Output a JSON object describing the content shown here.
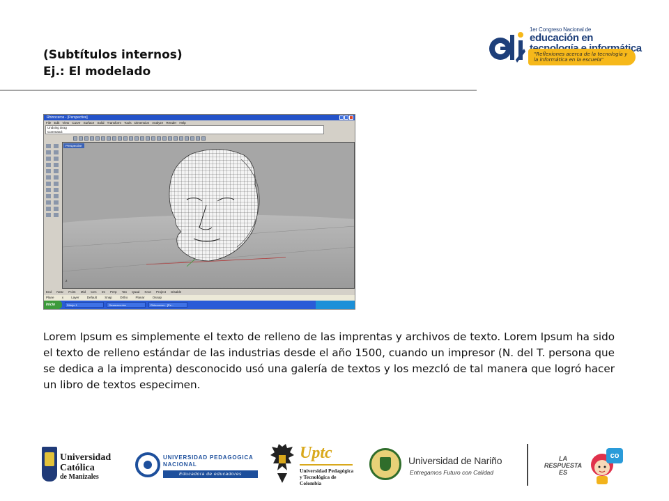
{
  "header": {
    "subtitle_line1": "(Subtítulos internos)",
    "subtitle_line2": "Ej.: El modelado"
  },
  "event_logo": {
    "mark": "eti",
    "line1": "1er Congreso Nacional de",
    "line2": "educación en",
    "line3": "tecnología e informática",
    "tagline": "\"Reflexiones acerca de la tecnología y la informática en la escuela\"",
    "accent_color": "#f6b81a",
    "brand_color": "#1e3f7a"
  },
  "screenshot": {
    "window_title": "Rhinoceros - [Perspective]",
    "menu": "File  Edit  View  Curve  Surface  Solid  Transform  Tools  Dimension  Analyze  Render  Help",
    "command_history": "Undoing Drag",
    "command_prompt": "Command:",
    "viewport_label": "Perspective",
    "osnap_row": "End  Near  Point  Mid  Cen  Int  Perp  Tan  Quad  Knot  Project  Disable",
    "status_row": "Plane  x  Layer  Default  Snap  Ortho  Planar  Osnap",
    "start_label": "Inicio",
    "tasks": [
      "Dibujo 1",
      "Gesaurus.doc",
      "Rhinoceros - [Pe..."
    ]
  },
  "body": {
    "paragraph": "Lorem Ipsum es simplemente el texto de relleno de las imprentas y archivos de texto. Lorem Ipsum ha sido el texto de relleno estándar de las industrias desde el año 1500, cuando un impresor (N. del T. persona que se dedica a la imprenta) desconocido usó una galería de textos y los mezcló de tal manera que logró hacer un libro de textos especimen."
  },
  "footer_logos": {
    "ucm": {
      "line1": "Universidad",
      "line2": "Católica",
      "line3": "de Manizales"
    },
    "upn": {
      "line1": "UNIVERSIDAD PEDAGOGICA",
      "line2": "NACIONAL",
      "slogan": "Educadora de educadores"
    },
    "uptc": {
      "name": "Uptc",
      "sub": "Universidad Pedagógica y Tecnológica de Colombia"
    },
    "unarino": {
      "name": "Universidad de Nariño",
      "slogan": "Entregamos Futuro con Calidad"
    },
    "la_respuesta": {
      "line1": "LA",
      "line2": "RESPUESTA",
      "line3": "ES",
      "badge": "co"
    }
  }
}
